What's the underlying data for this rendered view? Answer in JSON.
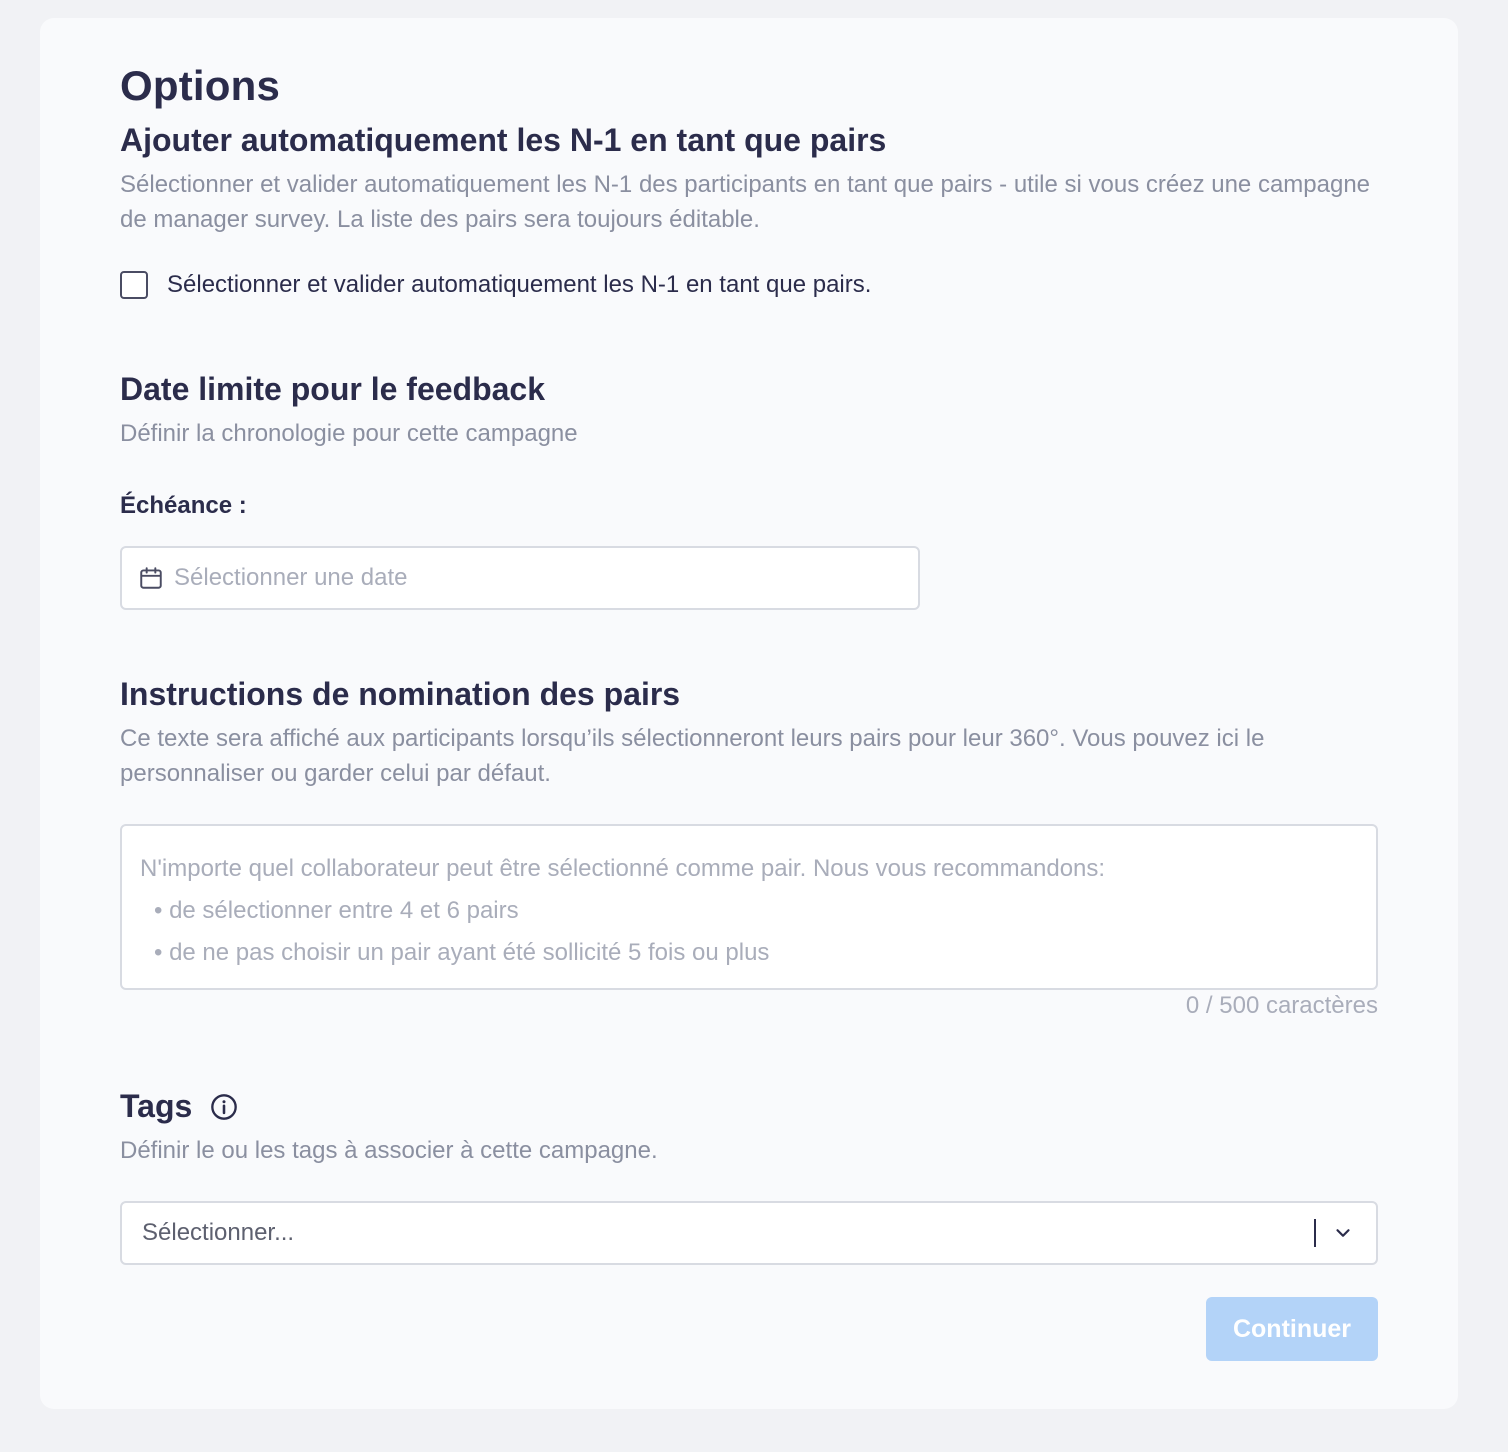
{
  "page": {
    "title": "Options"
  },
  "auto_peers": {
    "title": "Ajouter automatiquement les N-1 en tant que pairs",
    "description": "Sélectionner et valider automatiquement les N-1 des participants en tant que pairs - utile si vous créez une campagne de manager survey. La liste des pairs sera toujours éditable.",
    "checkbox_label": "Sélectionner et valider automatiquement les N-1 en tant que pairs.",
    "checked": false
  },
  "deadline": {
    "title": "Date limite pour le feedback",
    "description": "Définir la chronologie pour cette campagne",
    "field_label": "Échéance :",
    "date_placeholder": "Sélectionner une date"
  },
  "instructions": {
    "title": "Instructions de nomination des pairs",
    "description": "Ce texte sera affiché aux participants lorsqu’ils sélectionneront leurs pairs pour leur 360°. Vous pouvez ici le personnaliser ou garder celui par défaut.",
    "placeholder_intro": "N'importe quel collaborateur peut être sélectionné comme pair. Nous vous recommandons:",
    "placeholder_bullets": [
      "• de sélectionner entre 4 et 6 pairs",
      "• de ne pas choisir un pair ayant été sollicité 5 fois ou plus"
    ],
    "counter": "0 / 500 caractères"
  },
  "tags": {
    "title": "Tags",
    "info_icon": "info-icon",
    "description": "Définir le ou les tags à associer à cette campagne.",
    "select_placeholder": "Sélectionner..."
  },
  "actions": {
    "continue_label": "Continuer",
    "continue_enabled": false
  },
  "colors": {
    "page_bg": "#f1f2f5",
    "card_bg": "#f9fafc",
    "heading": "#2b2c4b",
    "muted_text": "#8a8fa0",
    "placeholder": "#a9adba",
    "border": "#d8dbe2",
    "button_disabled": "#b3d3f8"
  }
}
